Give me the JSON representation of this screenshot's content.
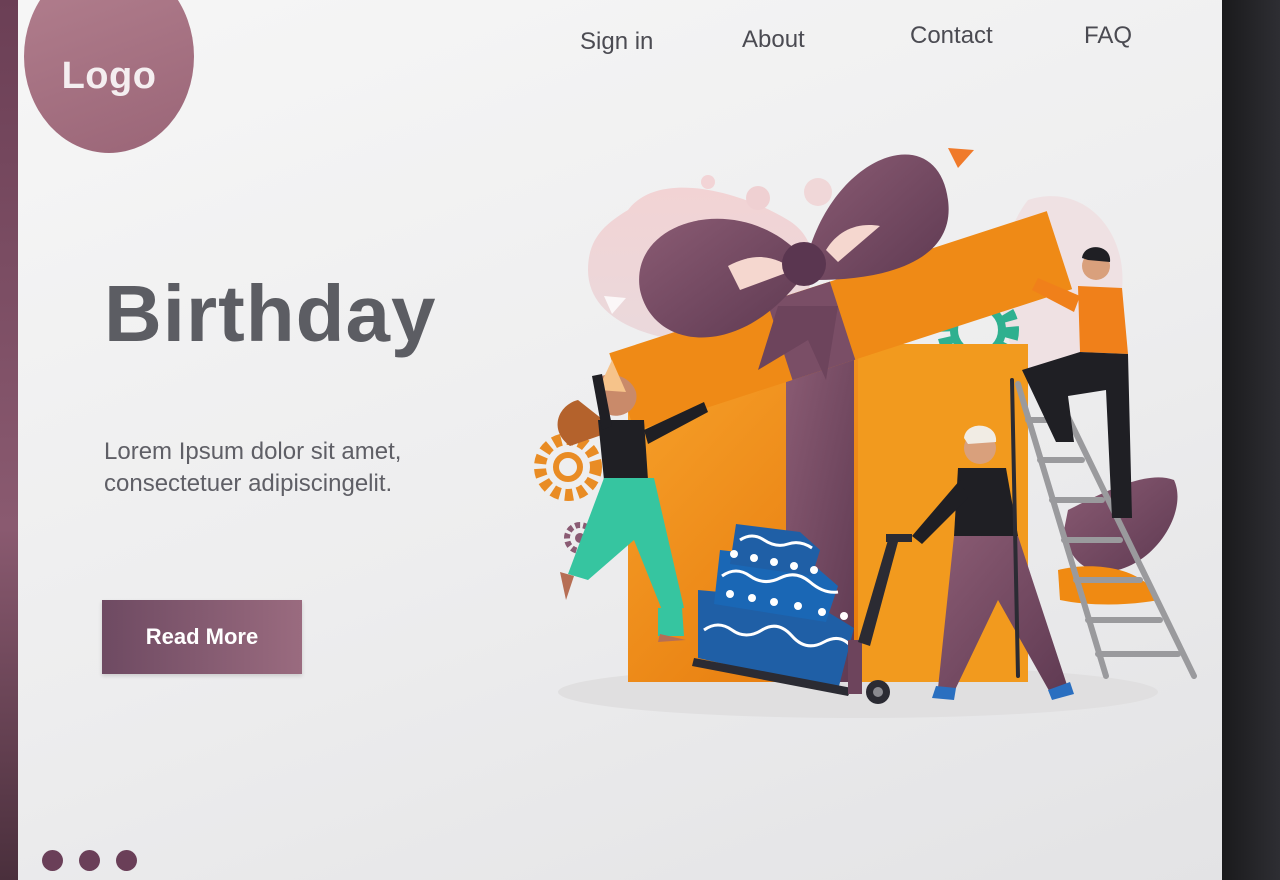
{
  "logo": {
    "text": "Logo"
  },
  "nav": {
    "items": [
      {
        "label": "Sign in"
      },
      {
        "label": "About"
      },
      {
        "label": "Contact"
      },
      {
        "label": "FAQ"
      }
    ]
  },
  "hero": {
    "title": "Birthday",
    "body": "Lorem Ipsum dolor sit amet, consectetuer adipiscingelit.",
    "cta_label": "Read More"
  },
  "pagination": {
    "dots": 3,
    "current": 1
  },
  "illustration": {
    "icon": "birthday-gift-illustration"
  },
  "colors": {
    "accent_purple": "#7a5266",
    "logo_circle": "#a8768a",
    "gift_orange": "#f08a12",
    "title_gray": "#5c5d63",
    "cake_blue": "#1f5fa6"
  }
}
